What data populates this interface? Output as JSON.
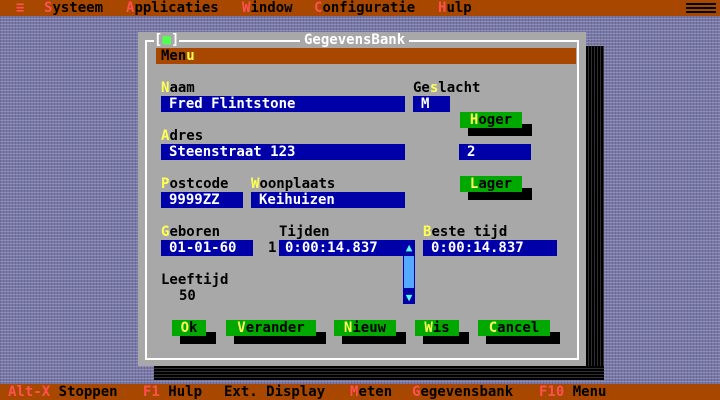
{
  "menubar": {
    "system_icon": "≡",
    "items": [
      {
        "hot": "S",
        "rest": "ysteem"
      },
      {
        "hot": "A",
        "rest": "pplicaties"
      },
      {
        "hot": "W",
        "rest": "indow"
      },
      {
        "hot": "C",
        "rest": "onfiguratie"
      },
      {
        "hot": "H",
        "rest": "ulp"
      }
    ]
  },
  "window": {
    "title": "GegevensBank",
    "close_left": "[",
    "close_glyph": "■",
    "close_right": "]",
    "menu_label_main": "Men",
    "menu_label_hot": "u"
  },
  "form": {
    "naam_hot": "N",
    "naam_rest": "aam",
    "naam_value": "Fred Flintstone",
    "geslacht_pre": "Ge",
    "geslacht_hot": "s",
    "geslacht_rest": "lacht",
    "geslacht_value": "M",
    "adres_hot": "A",
    "adres_rest": "dres",
    "adres_value": "Steenstraat 123",
    "counter_value": "2",
    "postcode_hot": "P",
    "postcode_rest": "ostcode",
    "postcode_value": "9999ZZ",
    "woonplaats_hot": "W",
    "woonplaats_rest": "oonplaats",
    "woonplaats_value": "Keihuizen",
    "geboren_hot": "G",
    "geboren_rest": "eboren",
    "geboren_value": "01-01-60",
    "tijden_label": "Tijden",
    "tijden_index": "1",
    "tijden_value": "0:00:14.837",
    "beste_hot": "B",
    "beste_rest": "este tijd",
    "beste_value": "0:00:14.837",
    "leeftijd_label": "Leeftijd",
    "leeftijd_value": "50"
  },
  "buttons": {
    "hoger_hot": "H",
    "hoger_rest": "oger",
    "lager_hot": "L",
    "lager_rest": "ager",
    "ok_hot": "O",
    "ok_rest": "k",
    "verander_hot": "V",
    "verander_rest": "erander",
    "nieuw_hot": "N",
    "nieuw_rest": "ieuw",
    "wis_hot": "W",
    "wis_rest": "is",
    "cancel_hot": "C",
    "cancel_rest": "ancel"
  },
  "scrollbar": {
    "up": "▲",
    "down": "▼"
  },
  "statusbar": [
    {
      "hot": "Alt-X",
      "rest": " Stoppen"
    },
    {
      "hot": "F1",
      "rest": " Hulp"
    },
    {
      "hot": "",
      "rest": "Ext. Display"
    },
    {
      "hot": "M",
      "rest": "eten"
    },
    {
      "hot": "G",
      "rest": "egevensbank"
    },
    {
      "hot": "F10",
      "rest": " Menu"
    }
  ],
  "colors": {
    "menubar": "#a84800",
    "field": "#0000a8",
    "button": "#00a800",
    "window": "#a8a8a8",
    "hotkey_red": "#ff5050",
    "hotkey_yellow": "#ffff54"
  }
}
